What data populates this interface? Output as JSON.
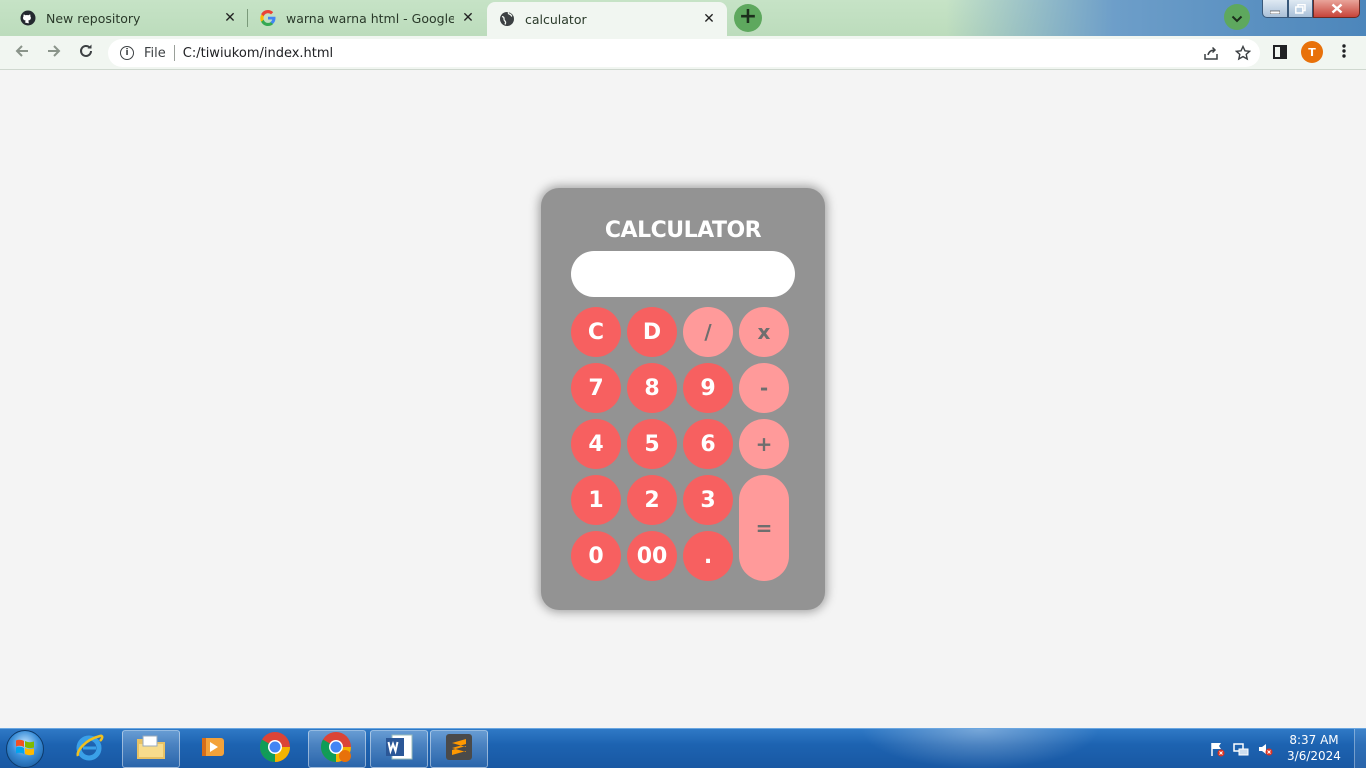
{
  "browser": {
    "tabs": [
      {
        "title": "New repository",
        "icon": "github-icon",
        "active": false
      },
      {
        "title": "warna warna html - Google Penelusuran",
        "icon": "google-icon",
        "active": false
      },
      {
        "title": "calculator",
        "icon": "globe-icon",
        "active": true
      }
    ],
    "close_glyph": "✕",
    "new_tab_glyph": "+",
    "address": {
      "scheme_label": "File",
      "url": "C:/tiwiukom/index.html"
    },
    "profile_initial": "T",
    "accent_color": "#5ea85e"
  },
  "page": {
    "calculator": {
      "title": "CALCULATOR",
      "display_value": "",
      "keys": {
        "clear": "C",
        "delete": "D",
        "divide": "/",
        "multiply": "x",
        "seven": "7",
        "eight": "8",
        "nine": "9",
        "minus": "-",
        "four": "4",
        "five": "5",
        "six": "6",
        "plus": "+",
        "one": "1",
        "two": "2",
        "three": "3",
        "equals": "=",
        "zero": "0",
        "double_zero": "00",
        "decimal": "."
      },
      "colors": {
        "body": "#939393",
        "key": "#f76060",
        "operator_key": "#ff9a9a"
      }
    }
  },
  "taskbar": {
    "apps": [
      "internet-explorer",
      "windows-explorer",
      "media-player",
      "google-chrome",
      "google-chrome-profile",
      "microsoft-word",
      "sublime-text"
    ],
    "clock": {
      "time": "8:37 AM",
      "date": "3/6/2024"
    }
  }
}
